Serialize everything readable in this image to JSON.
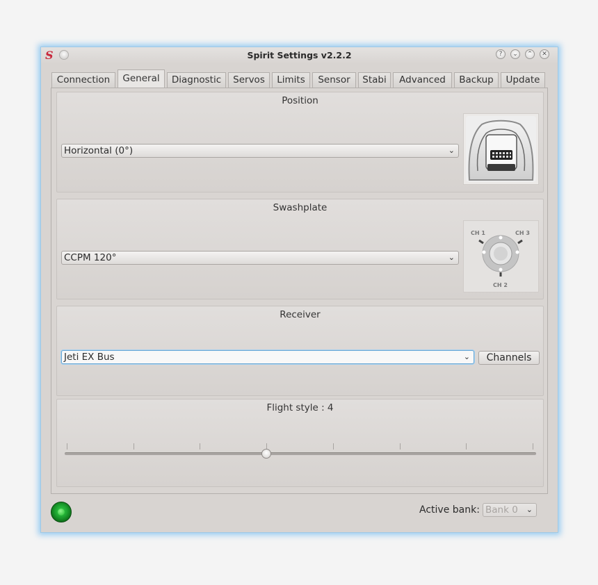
{
  "window": {
    "title": "Spirit Settings v2.2.2",
    "buttons": {
      "help": "?",
      "shade": "⌄",
      "maximize": "⌃",
      "close": "✕"
    }
  },
  "tabs": [
    {
      "label": "Connection"
    },
    {
      "label": "General",
      "active": true
    },
    {
      "label": "Diagnostic"
    },
    {
      "label": "Servos"
    },
    {
      "label": "Limits"
    },
    {
      "label": "Sensor"
    },
    {
      "label": "Stabi"
    },
    {
      "label": "Advanced"
    },
    {
      "label": "Backup"
    },
    {
      "label": "Update"
    }
  ],
  "position": {
    "title": "Position",
    "selected": "Horizontal (0°)"
  },
  "swashplate": {
    "title": "Swashplate",
    "selected": "CCPM 120°",
    "channel_labels": [
      "CH 1",
      "CH 3",
      "CH 2"
    ]
  },
  "receiver": {
    "title": "Receiver",
    "selected": "Jeti EX Bus",
    "channels_button": "Channels"
  },
  "flight_style": {
    "title": "Flight style : 4",
    "value": 4,
    "min": 1,
    "max": 8
  },
  "footer": {
    "active_bank_label": "Active bank:",
    "active_bank_value": "Bank 0",
    "connected": true
  },
  "colors": {
    "accent_focus": "#6aa7d4",
    "led_green": "#1ea531",
    "logo_red": "#c8283c"
  }
}
